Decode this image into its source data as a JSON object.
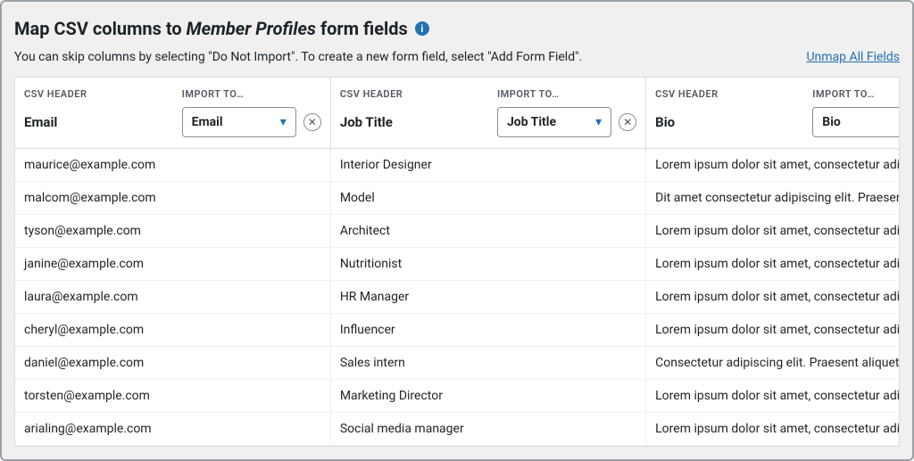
{
  "title_prefix": "Map CSV columns to ",
  "title_em": "Member Profiles",
  "title_suffix": " form fields",
  "info_icon_glyph": "i",
  "subtitle": "You can skip columns by selecting \"Do Not Import\". To create a new form field, select \"Add Form Field\".",
  "unmap_label": "Unmap All Fields",
  "labels": {
    "csv_header": "CSV HEADER",
    "import_to": "IMPORT TO…"
  },
  "columns": [
    {
      "csv_header": "Email",
      "import_to": "Email",
      "show_clear": true
    },
    {
      "csv_header": "Job Title",
      "import_to": "Job Title",
      "show_clear": true
    },
    {
      "csv_header": "Bio",
      "import_to": "Bio",
      "show_clear": false
    }
  ],
  "rows": [
    {
      "cells": [
        "maurice@example.com",
        "Interior Designer",
        "Lorem ipsum dolor sit amet, consectetur adipiscing"
      ]
    },
    {
      "cells": [
        "malcom@example.com",
        "Model",
        "Dit amet consectetur adipiscing elit. Praesent"
      ]
    },
    {
      "cells": [
        "tyson@example.com",
        "Architect",
        "Lorem ipsum dolor sit amet, consectetur adipiscing"
      ]
    },
    {
      "cells": [
        "janine@example.com",
        "Nutritionist",
        "Lorem ipsum dolor sit amet, consectetur adipiscing"
      ]
    },
    {
      "cells": [
        "laura@example.com",
        "HR Manager",
        "Lorem ipsum dolor sit amet, consectetur adipiscing"
      ]
    },
    {
      "cells": [
        "cheryl@example.com",
        "Influencer",
        "Lorem ipsum dolor sit amet, consectetur adipiscing"
      ]
    },
    {
      "cells": [
        "daniel@example.com",
        "Sales intern",
        "Consectetur adipiscing elit. Praesent aliquet"
      ]
    },
    {
      "cells": [
        "torsten@example.com",
        "Marketing Director",
        "Lorem ipsum dolor sit amet, consectetur adipiscing"
      ]
    },
    {
      "cells": [
        "arialing@example.com",
        "Social media manager",
        "Lorem ipsum dolor sit amet, consectetur adipiscing"
      ]
    }
  ]
}
